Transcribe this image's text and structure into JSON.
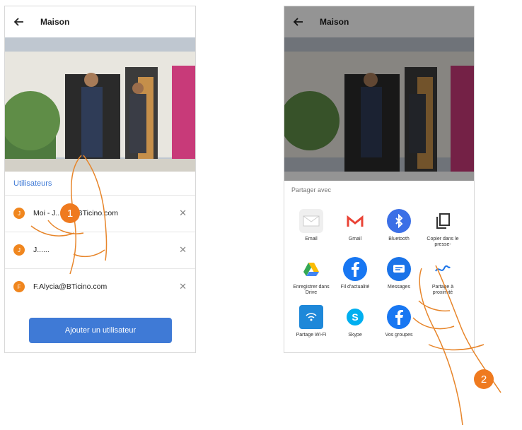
{
  "phone1": {
    "title": "Maison",
    "section_title": "Utilisateurs",
    "users": [
      {
        "initial": "J",
        "email": "Moi - J.....n@BTicino.com"
      },
      {
        "initial": "J",
        "email": "J......"
      },
      {
        "initial": "F",
        "email": "F.Alycia@BTicino.com"
      }
    ],
    "add_button": "Ajouter un utilisateur"
  },
  "phone2": {
    "title": "Maison",
    "share_title": "Partager avec",
    "items": [
      {
        "label": "Email",
        "icon": "email-icon"
      },
      {
        "label": "Gmail",
        "icon": "gmail-icon"
      },
      {
        "label": "Bluetooth",
        "icon": "bluetooth-icon"
      },
      {
        "label": "Copier dans le presse-",
        "icon": "copy-icon"
      },
      {
        "label": "Enregistrer dans Drive",
        "icon": "drive-icon"
      },
      {
        "label": "Fil d'actualité",
        "icon": "facebook-icon"
      },
      {
        "label": "Messages",
        "icon": "messages-icon"
      },
      {
        "label": "Partage à proximité",
        "icon": "nearby-share-icon"
      },
      {
        "label": "Partage Wi-Fi",
        "icon": "wifi-share-icon"
      },
      {
        "label": "Skype",
        "icon": "skype-icon"
      },
      {
        "label": "Vos groupes",
        "icon": "facebook-groups-icon"
      }
    ]
  },
  "markers": [
    "1",
    "2"
  ]
}
